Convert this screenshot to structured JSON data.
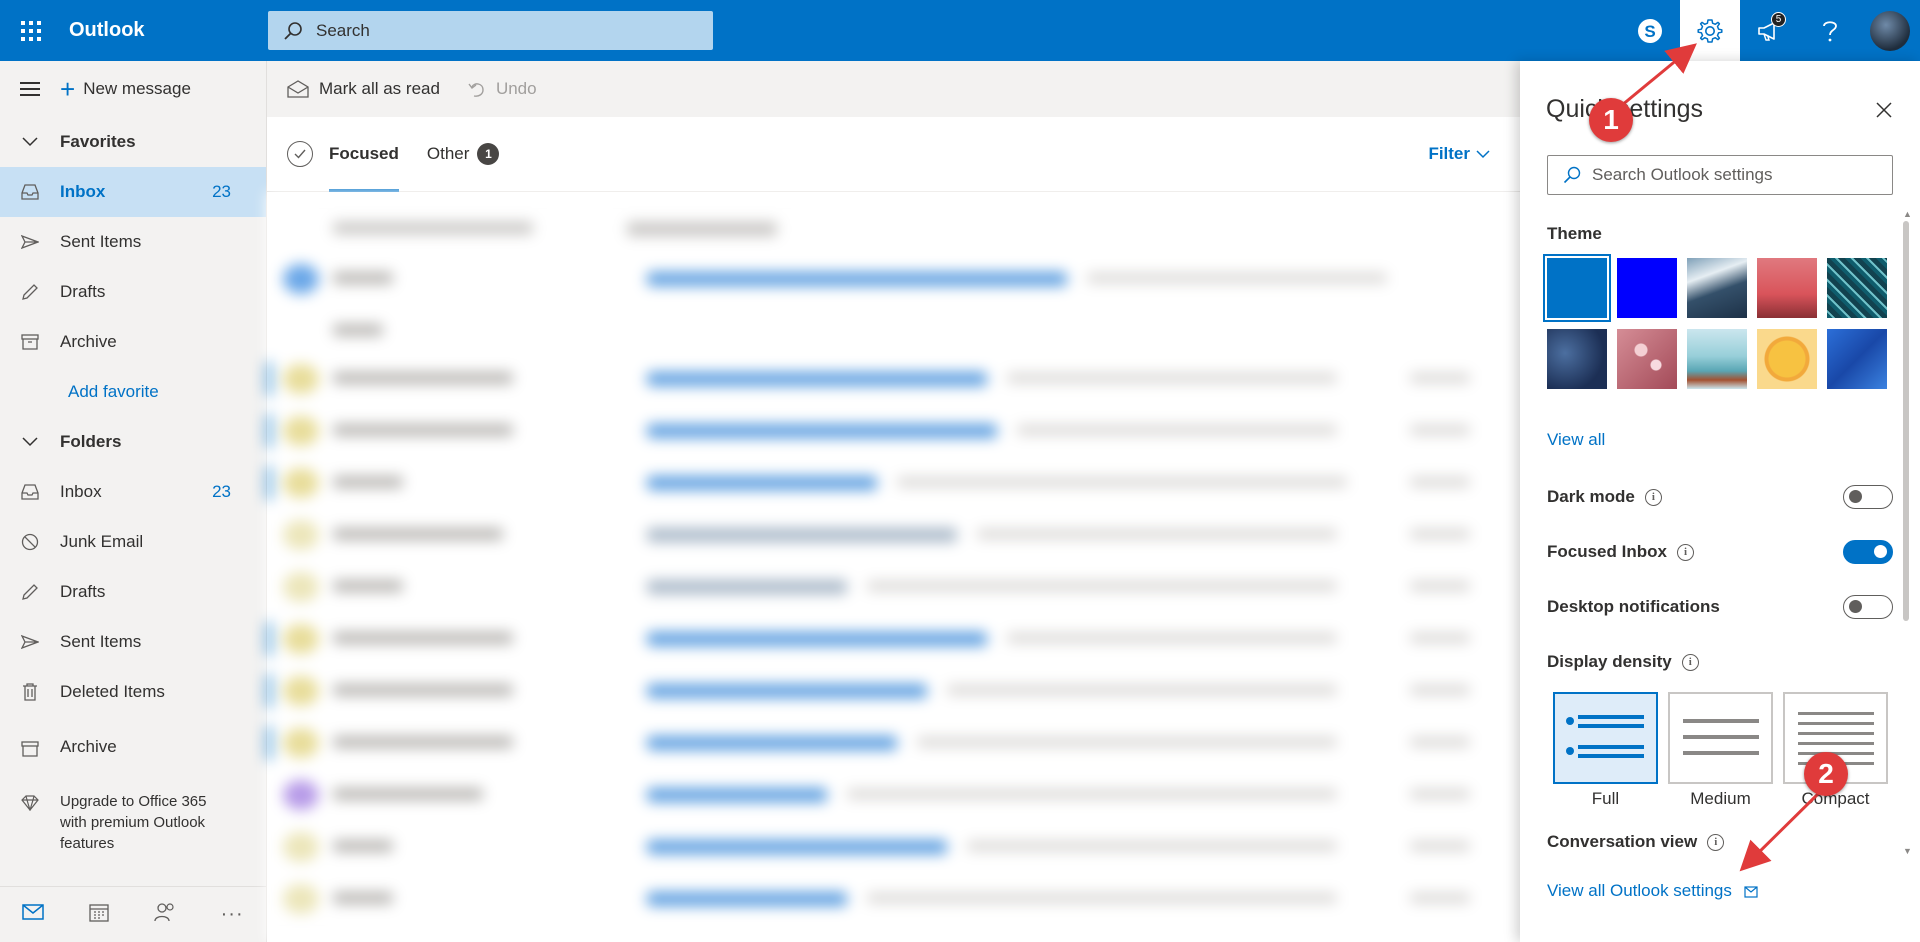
{
  "topbar": {
    "app_name": "Outlook",
    "search_placeholder": "Search",
    "notification_count": "5"
  },
  "commands": {
    "new_message": "New message",
    "mark_all_read": "Mark all as read",
    "undo": "Undo"
  },
  "nav": {
    "favorites_label": "Favorites",
    "favorites": [
      {
        "label": "Inbox",
        "count": "23"
      },
      {
        "label": "Sent Items",
        "count": ""
      },
      {
        "label": "Drafts",
        "count": ""
      },
      {
        "label": "Archive",
        "count": ""
      }
    ],
    "add_favorite": "Add favorite",
    "folders_label": "Folders",
    "folders": [
      {
        "label": "Inbox",
        "count": "23"
      },
      {
        "label": "Junk Email",
        "count": ""
      },
      {
        "label": "Drafts",
        "count": ""
      },
      {
        "label": "Sent Items",
        "count": ""
      },
      {
        "label": "Deleted Items",
        "count": ""
      },
      {
        "label": "Archive",
        "count": ""
      }
    ],
    "upgrade_text": "Upgrade to Office 365 with premium Outlook features"
  },
  "tabs": {
    "focused": "Focused",
    "other": "Other",
    "other_count": "1",
    "filter": "Filter"
  },
  "quick_settings": {
    "title": "Quick settings",
    "search_placeholder": "Search Outlook settings",
    "theme_label": "Theme",
    "view_all": "View all",
    "dark_mode": {
      "label": "Dark mode",
      "on": false
    },
    "focused_inbox": {
      "label": "Focused Inbox",
      "on": true
    },
    "desktop_notifications": {
      "label": "Desktop notifications",
      "on": false
    },
    "display_density_label": "Display density",
    "density_options": [
      "Full",
      "Medium",
      "Compact"
    ],
    "density_selected": "Full",
    "conversation_view_label": "Conversation view",
    "view_all_settings": "View all Outlook settings"
  },
  "annotations": {
    "marker1": "1",
    "marker2": "2"
  },
  "colors": {
    "brand_blue": "#0072c6",
    "annotation_red": "#e03b3b"
  }
}
